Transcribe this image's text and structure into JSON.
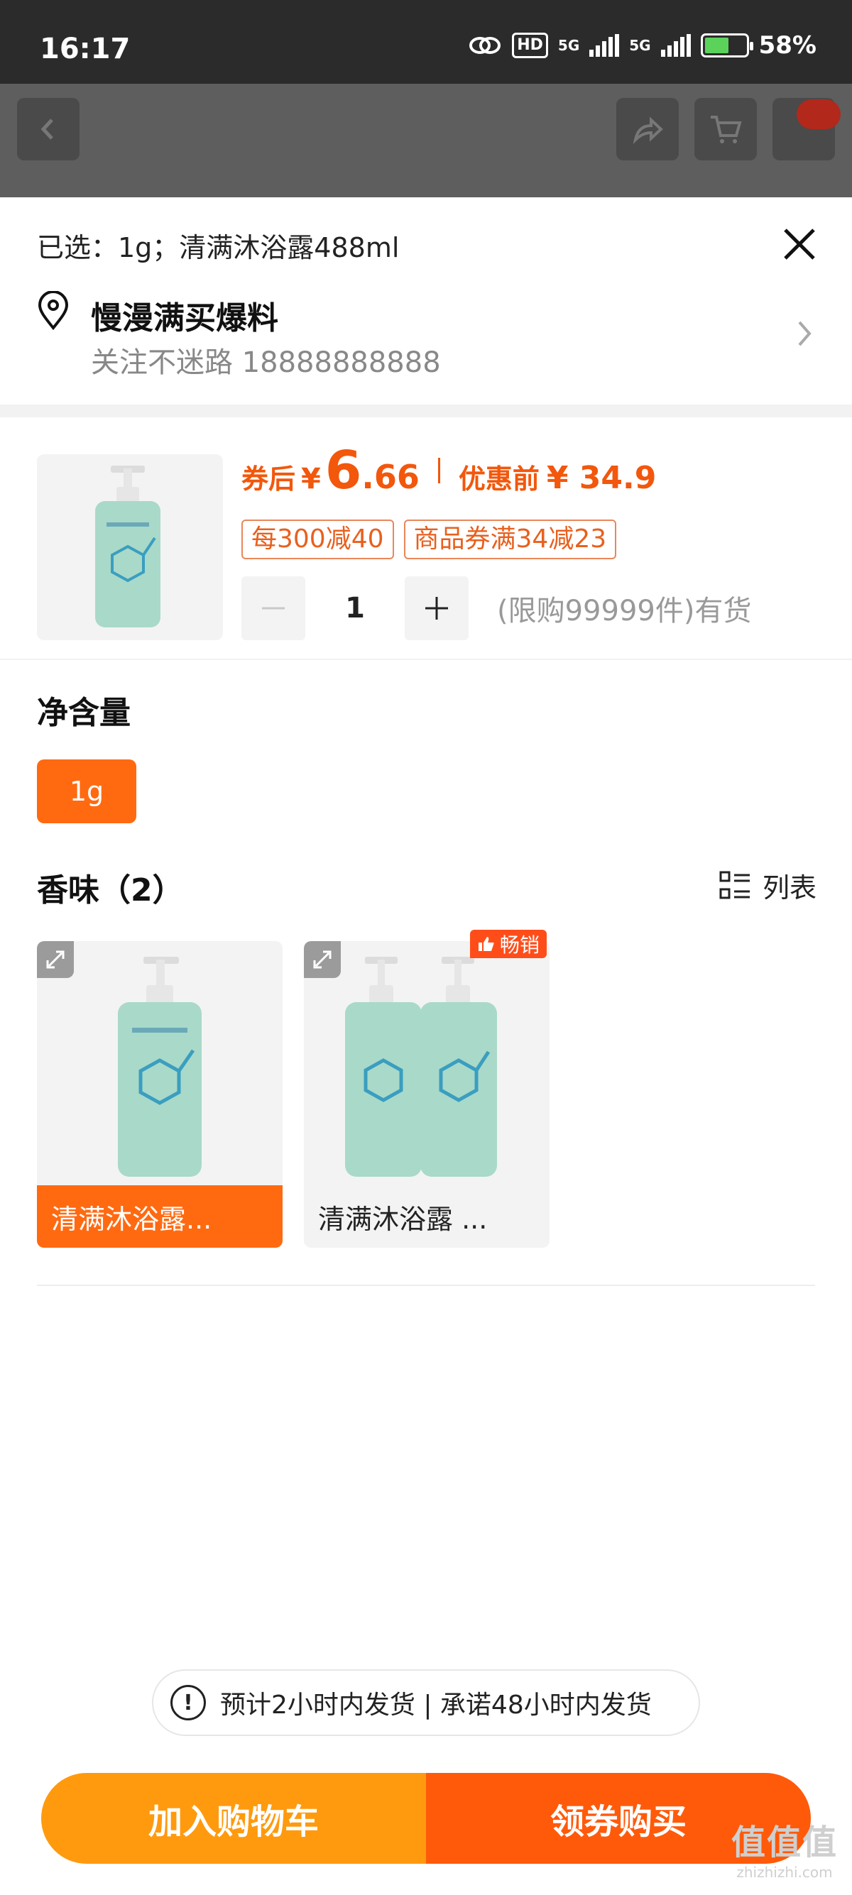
{
  "status": {
    "time": "16:17",
    "hd": "HD",
    "net1": "5G",
    "net2": "5G",
    "battery": "58%"
  },
  "sheet": {
    "selected": "已选：1g；清满沐浴露488ml",
    "address": {
      "name": "慢漫满买爆料",
      "detail": "关注不迷路 18888888888"
    }
  },
  "product": {
    "price_label": "券后",
    "currency": "¥",
    "price_int": "6",
    "price_dec": ".66",
    "orig_label": "优惠前",
    "orig_price": "¥ 34.9",
    "tags": [
      "每300减40",
      "商品券满34减23"
    ],
    "quantity": "1",
    "stock": "(限购99999件)有货"
  },
  "specs": {
    "net_title": "净含量",
    "net_option": "1g",
    "scent_title": "香味（2）",
    "list_label": "列表",
    "scent_options": [
      {
        "label": "清满沐浴露..."
      },
      {
        "label": "清满沐浴露 ..."
      }
    ],
    "hot_badge": "畅销"
  },
  "shipping": "预计2小时内发货 | 承诺48小时内发货",
  "actions": {
    "add_cart": "加入购物车",
    "buy": "领券购买"
  },
  "watermark": {
    "main": "值值值",
    "sub": "zhizhizhi.com"
  },
  "colors": {
    "accent": "#ff6a11",
    "price": "#f2570c",
    "cart": "#ff9a0e",
    "buy": "#ff5a0a"
  }
}
